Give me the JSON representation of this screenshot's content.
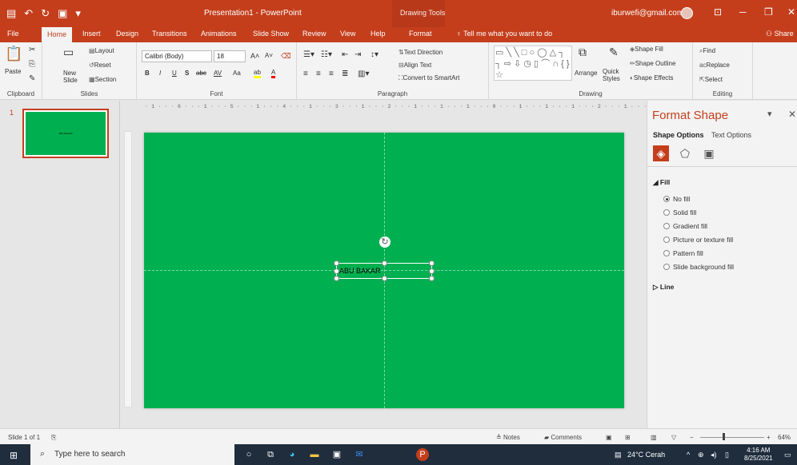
{
  "window": {
    "title": "Presentation1  -  PowerPoint",
    "context_tab_group": "Drawing Tools",
    "account": "iburwefi@gmail.com"
  },
  "tabs": [
    "File",
    "Home",
    "Insert",
    "Design",
    "Transitions",
    "Animations",
    "Slide Show",
    "Review",
    "View",
    "Help",
    "Format"
  ],
  "active_tab": "Home",
  "tell_me": "Tell me what you want to do",
  "share": "Share",
  "ribbon": {
    "clipboard": {
      "paste": "Paste",
      "label": "Clipboard"
    },
    "slides": {
      "new_slide": "New Slide",
      "layout": "Layout",
      "reset": "Reset",
      "section": "Section",
      "label": "Slides"
    },
    "font": {
      "name": "Calibri (Body)",
      "size": "18",
      "bold": "B",
      "italic": "I",
      "underline": "U",
      "shadow": "S",
      "strike": "abc",
      "spacing": "AV",
      "case": "Aa",
      "label": "Font"
    },
    "paragraph": {
      "text_direction": "Text Direction",
      "align_text": "Align Text",
      "convert_smartart": "Convert to SmartArt",
      "label": "Paragraph"
    },
    "drawing": {
      "arrange": "Arrange",
      "quick_styles": "Quick Styles",
      "shape_fill": "Shape Fill",
      "shape_outline": "Shape Outline",
      "shape_effects": "Shape Effects",
      "label": "Drawing"
    },
    "editing": {
      "find": "Find",
      "replace": "Replace",
      "select": "Select",
      "label": "Editing"
    }
  },
  "thumbnails": {
    "slide_number": "1",
    "thumb_text": "ABU BAKAR"
  },
  "ruler": {
    "horizontal": "· 1 · · · 6 · · · 1 · · · 5 · · · 1 · · · 4 · · · 1 · · · 3 · · · 1 · · · 2 · · · 1 · · · 1 · · · 1 · · · 0 · · · 1 · · · 1 · · · 1 · · · 2 · · · 1 · · · 3 · · · 1 · · · 4 · · · 1 · · · 5 · · · 1 · · · 6 · · · 1 ·"
  },
  "slide": {
    "background": "#00b050",
    "textbox_text": "ABU BAKAR"
  },
  "format_pane": {
    "title": "Format Shape",
    "tab_shape": "Shape Options",
    "tab_text": "Text Options",
    "fill_section": "Fill",
    "fill_options": [
      "No fill",
      "Solid fill",
      "Gradient fill",
      "Picture or texture fill",
      "Pattern fill",
      "Slide background fill"
    ],
    "selected_fill": "No fill",
    "line_section": "Line"
  },
  "status": {
    "slide_count": "Slide 1 of 1",
    "notes": "Notes",
    "comments": "Comments",
    "zoom": "64%"
  },
  "taskbar": {
    "search_placeholder": "Type here to search",
    "weather": "24°C  Cerah",
    "time": "4:16 AM",
    "date": "8/25/2021"
  },
  "colors": {
    "accent": "#c43e1c",
    "slide_green": "#00b050"
  }
}
